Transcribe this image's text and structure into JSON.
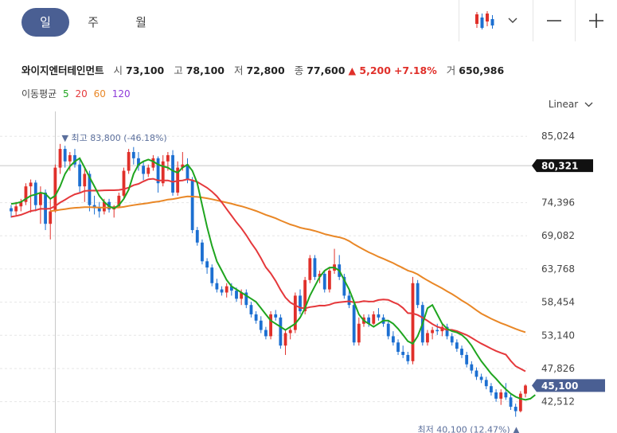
{
  "tabs": [
    "일",
    "주",
    "월"
  ],
  "active_tab": 0,
  "toolbar": {
    "chart_type_icon": "candlestick-icon",
    "minus_icon": "minus-icon",
    "plus_icon": "plus-icon"
  },
  "quote": {
    "name": "와이지엔터테인먼트",
    "open_label": "시",
    "open": "73,100",
    "high_label": "고",
    "high": "78,100",
    "low_label": "저",
    "low": "72,800",
    "close_label": "종",
    "close": "77,600",
    "change": "▲ 5,200",
    "change_pct": "+7.18%",
    "volume_label": "거",
    "volume": "650,986"
  },
  "moving_average": {
    "label": "이동평균",
    "periods": [
      {
        "label": "5",
        "color": "#1fa51f"
      },
      {
        "label": "20",
        "color": "#e5383b"
      },
      {
        "label": "60",
        "color": "#e98726"
      },
      {
        "label": "120",
        "color": "#8e3ad9"
      }
    ]
  },
  "scale_label": "Linear",
  "colors": {
    "up": "#e0302a",
    "down": "#1c6fd1",
    "ma5": "#1fa51f",
    "ma20": "#e5383b",
    "ma60": "#e98726",
    "ma120": "#8e3ad9",
    "current_tag": "#4a5f93",
    "crosshair_tag": "#111111"
  },
  "chart_data": {
    "type": "candlestick",
    "y_ticks": [
      "85,024",
      "74,396",
      "69,082",
      "63,768",
      "58,454",
      "53,140",
      "47,826",
      "42,512"
    ],
    "ylim": [
      37500,
      89000
    ],
    "crosshair_value": "80,321",
    "current_price": "45,100",
    "max_annotation": "▼ 최고 83,800 (-46.18%)",
    "min_annotation": "최저 40,100 (12.47%) ▲",
    "candles": [
      [
        73500,
        74000,
        72000,
        73000
      ],
      [
        73000,
        74500,
        72200,
        73800
      ],
      [
        73800,
        75000,
        73000,
        74500
      ],
      [
        74500,
        77500,
        74000,
        77000
      ],
      [
        77000,
        78100,
        72800,
        77600
      ],
      [
        77600,
        78000,
        73000,
        74000
      ],
      [
        74000,
        77000,
        71000,
        76000
      ],
      [
        76000,
        76500,
        70000,
        71000
      ],
      [
        71000,
        75000,
        68500,
        73000
      ],
      [
        73000,
        80500,
        72800,
        80000
      ],
      [
        80000,
        83800,
        79000,
        83000
      ],
      [
        83000,
        83500,
        80000,
        81000
      ],
      [
        81000,
        82500,
        79500,
        82000
      ],
      [
        82000,
        83000,
        80000,
        80500
      ],
      [
        80500,
        81500,
        76000,
        77000
      ],
      [
        77000,
        80000,
        74500,
        79000
      ],
      [
        79000,
        79500,
        73000,
        74000
      ],
      [
        74000,
        75500,
        72500,
        73500
      ],
      [
        73500,
        74500,
        72000,
        73000
      ],
      [
        73000,
        75000,
        72500,
        74500
      ],
      [
        74500,
        75000,
        72800,
        73300
      ],
      [
        73300,
        74000,
        72000,
        73800
      ],
      [
        73800,
        76000,
        73500,
        75500
      ],
      [
        75500,
        80000,
        75000,
        79500
      ],
      [
        79500,
        83000,
        79000,
        82500
      ],
      [
        82500,
        83300,
        80500,
        81500
      ],
      [
        81500,
        82500,
        79500,
        80300
      ],
      [
        80300,
        81000,
        78000,
        79000
      ],
      [
        79000,
        80500,
        78500,
        80000
      ],
      [
        80000,
        82000,
        79500,
        81500
      ],
      [
        81500,
        81800,
        76000,
        77500
      ],
      [
        77500,
        82000,
        77000,
        81000
      ],
      [
        81000,
        82500,
        79500,
        82000
      ],
      [
        82000,
        82800,
        75500,
        76000
      ],
      [
        76000,
        81000,
        75500,
        80000
      ],
      [
        80000,
        82500,
        79500,
        80500
      ],
      [
        80500,
        81500,
        77500,
        78000
      ],
      [
        78000,
        78500,
        69500,
        70000
      ],
      [
        70000,
        70500,
        67500,
        68000
      ],
      [
        68000,
        68500,
        64500,
        65000
      ],
      [
        65000,
        65500,
        63000,
        64000
      ],
      [
        64000,
        64500,
        61000,
        61500
      ],
      [
        61500,
        62200,
        60000,
        60500
      ],
      [
        60500,
        61000,
        59500,
        60000
      ],
      [
        60000,
        61500,
        59200,
        61000
      ],
      [
        61000,
        61500,
        59500,
        60300
      ],
      [
        60300,
        60800,
        58500,
        59000
      ],
      [
        59000,
        60500,
        58000,
        60000
      ],
      [
        60000,
        60500,
        57500,
        58000
      ],
      [
        58000,
        58500,
        56000,
        56500
      ],
      [
        56500,
        57000,
        55000,
        55500
      ],
      [
        55500,
        56200,
        53500,
        54000
      ],
      [
        54000,
        54500,
        52500,
        53000
      ],
      [
        53000,
        57000,
        52500,
        56500
      ],
      [
        56500,
        57200,
        55500,
        56000
      ],
      [
        56000,
        56500,
        51000,
        51500
      ],
      [
        51500,
        54000,
        50000,
        53500
      ],
      [
        53500,
        54500,
        52500,
        54000
      ],
      [
        54000,
        60000,
        53500,
        59500
      ],
      [
        59500,
        60500,
        56500,
        57000
      ],
      [
        57000,
        62500,
        56500,
        62000
      ],
      [
        62000,
        66000,
        61500,
        65500
      ],
      [
        65500,
        66000,
        62000,
        62500
      ],
      [
        62500,
        63500,
        61500,
        63000
      ],
      [
        63000,
        63500,
        60000,
        60500
      ],
      [
        60500,
        64000,
        60000,
        63500
      ],
      [
        63500,
        67000,
        63000,
        64500
      ],
      [
        64500,
        66000,
        62000,
        62500
      ],
      [
        62500,
        63000,
        59000,
        59500
      ],
      [
        59500,
        60500,
        57500,
        58000
      ],
      [
        58000,
        58500,
        51500,
        52000
      ],
      [
        52000,
        56000,
        51500,
        55000
      ],
      [
        55000,
        56500,
        54500,
        56000
      ],
      [
        56000,
        56500,
        54500,
        55000
      ],
      [
        55000,
        57000,
        54800,
        56500
      ],
      [
        56500,
        57500,
        55500,
        56000
      ],
      [
        56000,
        56500,
        54500,
        55000
      ],
      [
        55000,
        55500,
        52500,
        53000
      ],
      [
        53000,
        53800,
        51500,
        52000
      ],
      [
        52000,
        52500,
        50000,
        50500
      ],
      [
        50500,
        51500,
        49500,
        50000
      ],
      [
        50000,
        50500,
        48500,
        49000
      ],
      [
        49000,
        62500,
        48500,
        61500
      ],
      [
        61500,
        62000,
        57500,
        58000
      ],
      [
        58000,
        58500,
        51500,
        52000
      ],
      [
        52000,
        54000,
        51500,
        53500
      ],
      [
        53500,
        54500,
        52500,
        54000
      ],
      [
        54000,
        55000,
        53200,
        53800
      ],
      [
        53800,
        55000,
        53000,
        54500
      ],
      [
        54500,
        55000,
        52500,
        53000
      ],
      [
        53000,
        53500,
        51500,
        52000
      ],
      [
        52000,
        52500,
        50500,
        51000
      ],
      [
        51000,
        51500,
        49500,
        50000
      ],
      [
        50000,
        50500,
        48000,
        48500
      ],
      [
        48500,
        49000,
        47000,
        47500
      ],
      [
        47500,
        48000,
        46000,
        46500
      ],
      [
        46500,
        47000,
        45500,
        46000
      ],
      [
        46000,
        46500,
        44500,
        45000
      ],
      [
        45000,
        45500,
        43500,
        44000
      ],
      [
        44000,
        44500,
        42500,
        43000
      ],
      [
        43000,
        44500,
        42000,
        44000
      ],
      [
        44000,
        45500,
        42800,
        43200
      ],
      [
        43200,
        43800,
        41200,
        41700
      ],
      [
        41700,
        42200,
        40100,
        41000
      ],
      [
        41000,
        44200,
        40800,
        43800
      ],
      [
        43800,
        45300,
        43200,
        45100
      ]
    ],
    "ma5": [
      74200,
      74300,
      74500,
      75000,
      75500,
      75700,
      76000,
      75800,
      75000,
      75500,
      77000,
      79000,
      80200,
      81000,
      81500,
      80000,
      78500,
      77000,
      75500,
      74500,
      73800,
      73500,
      74000,
      75000,
      76500,
      79000,
      80500,
      81000,
      81300,
      81000,
      80500,
      80200,
      80000,
      79500,
      79200,
      80000,
      80500,
      79500,
      77500,
      74000,
      70500,
      67500,
      65000,
      63500,
      62000,
      61000,
      60500,
      60000,
      59500,
      59000,
      58500,
      57500,
      56500,
      55500,
      55000,
      54500,
      54000,
      54500,
      55000,
      56000,
      57500,
      59500,
      61000,
      62500,
      63500,
      64000,
      64000,
      63500,
      62000,
      60500,
      58500,
      56500,
      55500,
      55000,
      54500,
      55000,
      55500,
      55500,
      55000,
      54200,
      53200,
      52200,
      51800,
      53000,
      55000,
      57500,
      58000,
      56500,
      55000,
      54200,
      53800,
      53600,
      53200,
      52500,
      51500,
      50200,
      49000,
      48000,
      47000,
      46200,
      45300,
      44500,
      43800,
      43300,
      43000,
      42800,
      43000,
      43600
    ]
  }
}
